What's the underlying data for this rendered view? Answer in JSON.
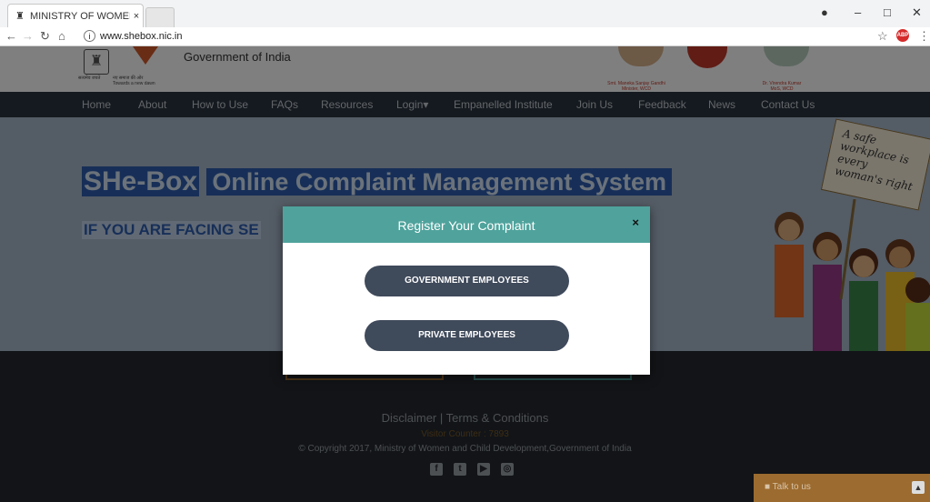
{
  "browser": {
    "tab_title": "MINISTRY OF WOMEN &",
    "tab_close": "×",
    "url": "www.shebox.nic.in",
    "icons": [
      "back-arrow-icon",
      "forward-arrow-icon",
      "reload-icon",
      "home-icon",
      "info-icon",
      "star-icon",
      "abp-icon",
      "menu-icon",
      "account-icon",
      "minimize-icon",
      "restore-icon",
      "close-icon"
    ],
    "abp": "ABP"
  },
  "header": {
    "gov_title": "Government of India",
    "emblem_caption": "सत्यमेव जयते",
    "tagline_hindi": "नए समाज की ओर",
    "tagline_en": "Towards a new dawn",
    "minister1": "Smt. Maneka Sanjay Gandhi",
    "minister1_role": "Minister, WCD",
    "minister2": "Dr. Virendra Kumar",
    "minister2_role": "MoS, WCD"
  },
  "nav": {
    "items": [
      "Home",
      "About",
      "How to Use",
      "FAQs",
      "Resources",
      "Login",
      "Empanelled Institute",
      "Join Us",
      "Feedback",
      "News",
      "Contact Us"
    ],
    "caret": "▾"
  },
  "hero": {
    "brand": "SHe-Box",
    "title": "Online Complaint Management System",
    "subtitle": "IF YOU ARE FACING SE",
    "sign_text": "A safe workplace is every woman's right"
  },
  "footer": {
    "disclaimer": "Disclaimer",
    "separator": "|",
    "terms": "Terms & Conditions",
    "counter": "Visitor Counter : 7893",
    "copyright": "© Copyright 2017, Ministry of Women and Child Development,Government of India",
    "social": [
      "f",
      "t",
      "▶",
      "◎"
    ]
  },
  "talk": {
    "label": "Talk to us",
    "up": "▲"
  },
  "modal": {
    "title": "Register Your Complaint",
    "close": "×",
    "btn_government": "GOVERNMENT EMPLOYEES",
    "btn_private": "PRIVATE EMPLOYEES"
  },
  "colors": {
    "modal_header": "#4fa39c",
    "button": "#3f4a5b",
    "nav": "#2b3440",
    "footer": "#25292e"
  }
}
